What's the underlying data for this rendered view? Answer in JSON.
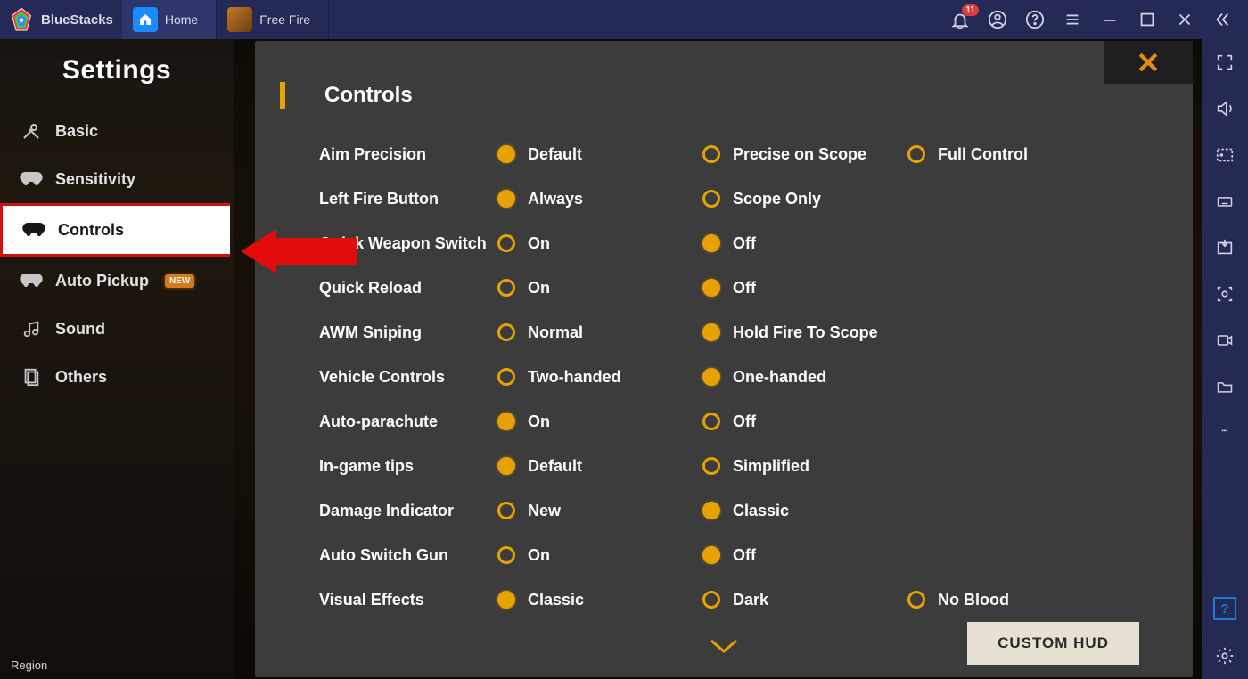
{
  "titlebar": {
    "app_name": "BlueStacks",
    "notification_count": "11",
    "tabs": [
      {
        "label": "Home"
      },
      {
        "label": "Free Fire"
      }
    ]
  },
  "sidebar": {
    "title": "Settings",
    "region": "Region",
    "items": [
      {
        "label": "Basic"
      },
      {
        "label": "Sensitivity"
      },
      {
        "label": "Controls"
      },
      {
        "label": "Auto Pickup",
        "new": true
      },
      {
        "label": "Sound"
      },
      {
        "label": "Others"
      }
    ]
  },
  "panel": {
    "title": "Controls",
    "custom_hud": "CUSTOM HUD",
    "rows": [
      {
        "label": "Aim Precision",
        "options": [
          "Default",
          "Precise on Scope",
          "Full Control"
        ],
        "selected": 0
      },
      {
        "label": "Left Fire Button",
        "options": [
          "Always",
          "Scope Only"
        ],
        "selected": 0
      },
      {
        "label": "Quick Weapon Switch",
        "options": [
          "On",
          "Off"
        ],
        "selected": 1
      },
      {
        "label": "Quick Reload",
        "options": [
          "On",
          "Off"
        ],
        "selected": 1
      },
      {
        "label": "AWM Sniping",
        "options": [
          "Normal",
          "Hold Fire To Scope"
        ],
        "selected": 1
      },
      {
        "label": "Vehicle Controls",
        "options": [
          "Two-handed",
          "One-handed"
        ],
        "selected": 1
      },
      {
        "label": "Auto-parachute",
        "options": [
          "On",
          "Off"
        ],
        "selected": 0
      },
      {
        "label": "In-game tips",
        "options": [
          "Default",
          "Simplified"
        ],
        "selected": 0
      },
      {
        "label": "Damage Indicator",
        "options": [
          "New",
          "Classic"
        ],
        "selected": 1
      },
      {
        "label": "Auto Switch Gun",
        "options": [
          "On",
          "Off"
        ],
        "selected": 1
      },
      {
        "label": "Visual Effects",
        "options": [
          "Classic",
          "Dark",
          "No Blood"
        ],
        "selected": 0
      }
    ]
  }
}
